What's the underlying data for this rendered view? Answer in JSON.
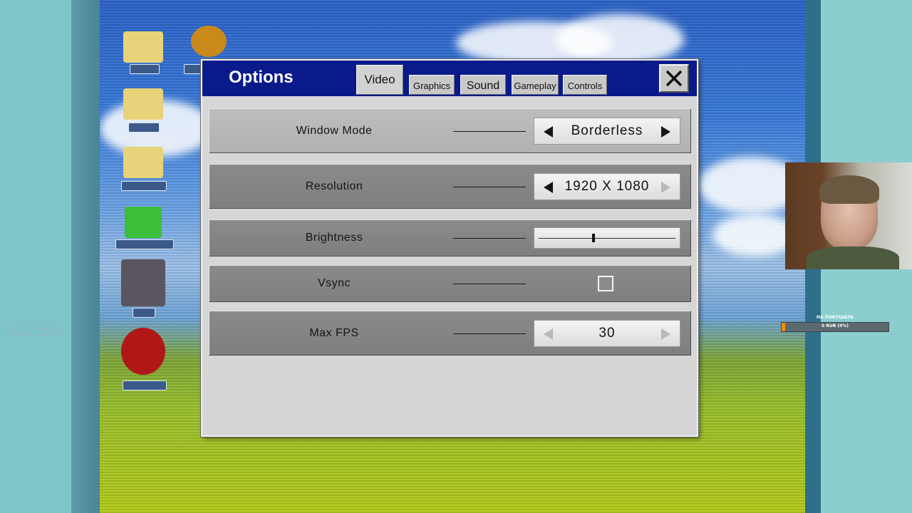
{
  "window": {
    "title": "Options",
    "tabs": [
      {
        "label": "Video",
        "active": true
      },
      {
        "label": "Graphics",
        "active": false
      },
      {
        "label": "Sound",
        "active": false
      },
      {
        "label": "Gameplay",
        "active": false
      },
      {
        "label": "Controls",
        "active": false
      }
    ],
    "close_icon": "close-icon"
  },
  "settings": {
    "window_mode": {
      "label": "Window Mode",
      "value": "Borderless"
    },
    "resolution": {
      "label": "Resolution",
      "value": "1920 X 1080"
    },
    "brightness": {
      "label": "Brightness",
      "level": 0.4
    },
    "vsync": {
      "label": "Vsync",
      "checked": false
    },
    "max_fps": {
      "label": "Max FPS",
      "value": "30"
    }
  },
  "overlay": {
    "log_text": "\"error\": \"Request bloc\n\"reference\": \"0e0db7e\"",
    "donation_title": "НА ПОКУШАТЬ",
    "donation_amount": "0 RUB (0%)",
    "donation_progress": 0.03
  },
  "colors": {
    "titlebar": "#0a1a8a",
    "window_bg": "#d6d6d6",
    "donation_fill": "#ff8a00"
  }
}
